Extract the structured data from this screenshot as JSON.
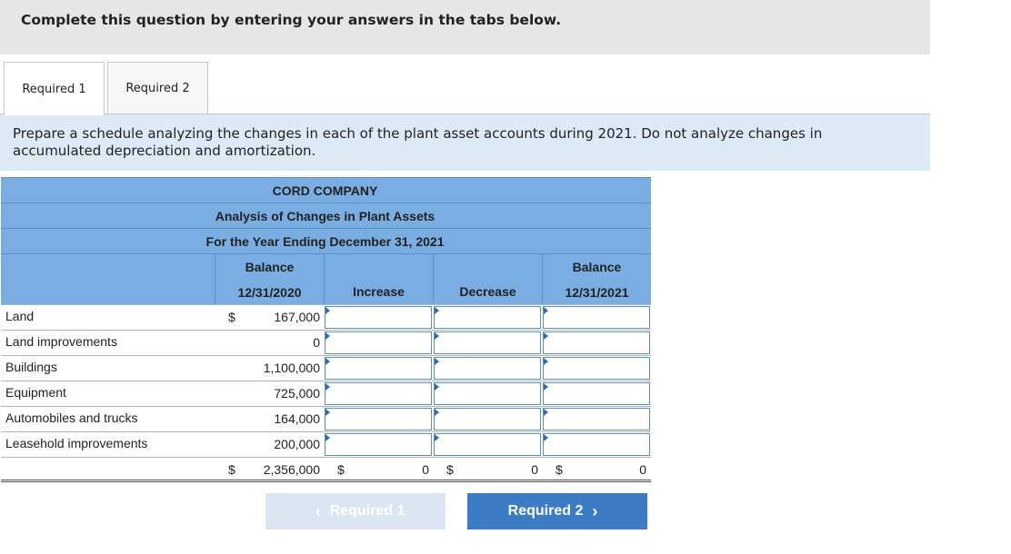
{
  "instructions": "Complete this question by entering your answers in the tabs below.",
  "tabs": [
    {
      "label": "Required 1",
      "active": true
    },
    {
      "label": "Required 2",
      "active": false
    }
  ],
  "prompt": "Prepare a schedule analyzing the changes in each of the plant asset accounts during 2021. Do not analyze changes in accumulated depreciation and amortization.",
  "schedule": {
    "company": "CORD COMPANY",
    "title": "Analysis of Changes in Plant Assets",
    "period": "For the Year Ending December 31, 2021",
    "columns": {
      "balance_begin_1": "Balance",
      "balance_begin_2": "12/31/2020",
      "increase": "Increase",
      "decrease": "Decrease",
      "balance_end_1": "Balance",
      "balance_end_2": "12/31/2021"
    },
    "rows": [
      {
        "label": "Land",
        "dollar": "$",
        "balance": "167,000"
      },
      {
        "label": "Land improvements",
        "dollar": "",
        "balance": "0"
      },
      {
        "label": "Buildings",
        "dollar": "",
        "balance": "1,100,000"
      },
      {
        "label": "Equipment",
        "dollar": "",
        "balance": "725,000"
      },
      {
        "label": "Automobiles and trucks",
        "dollar": "",
        "balance": "164,000"
      },
      {
        "label": "Leasehold improvements",
        "dollar": "",
        "balance": "200,000"
      }
    ],
    "totals": {
      "dollar": "$",
      "balance": "2,356,000",
      "increase": "0",
      "decrease": "0",
      "ending": "0"
    }
  },
  "nav": {
    "prev_label": "Required 1",
    "next_label": "Required 2"
  }
}
